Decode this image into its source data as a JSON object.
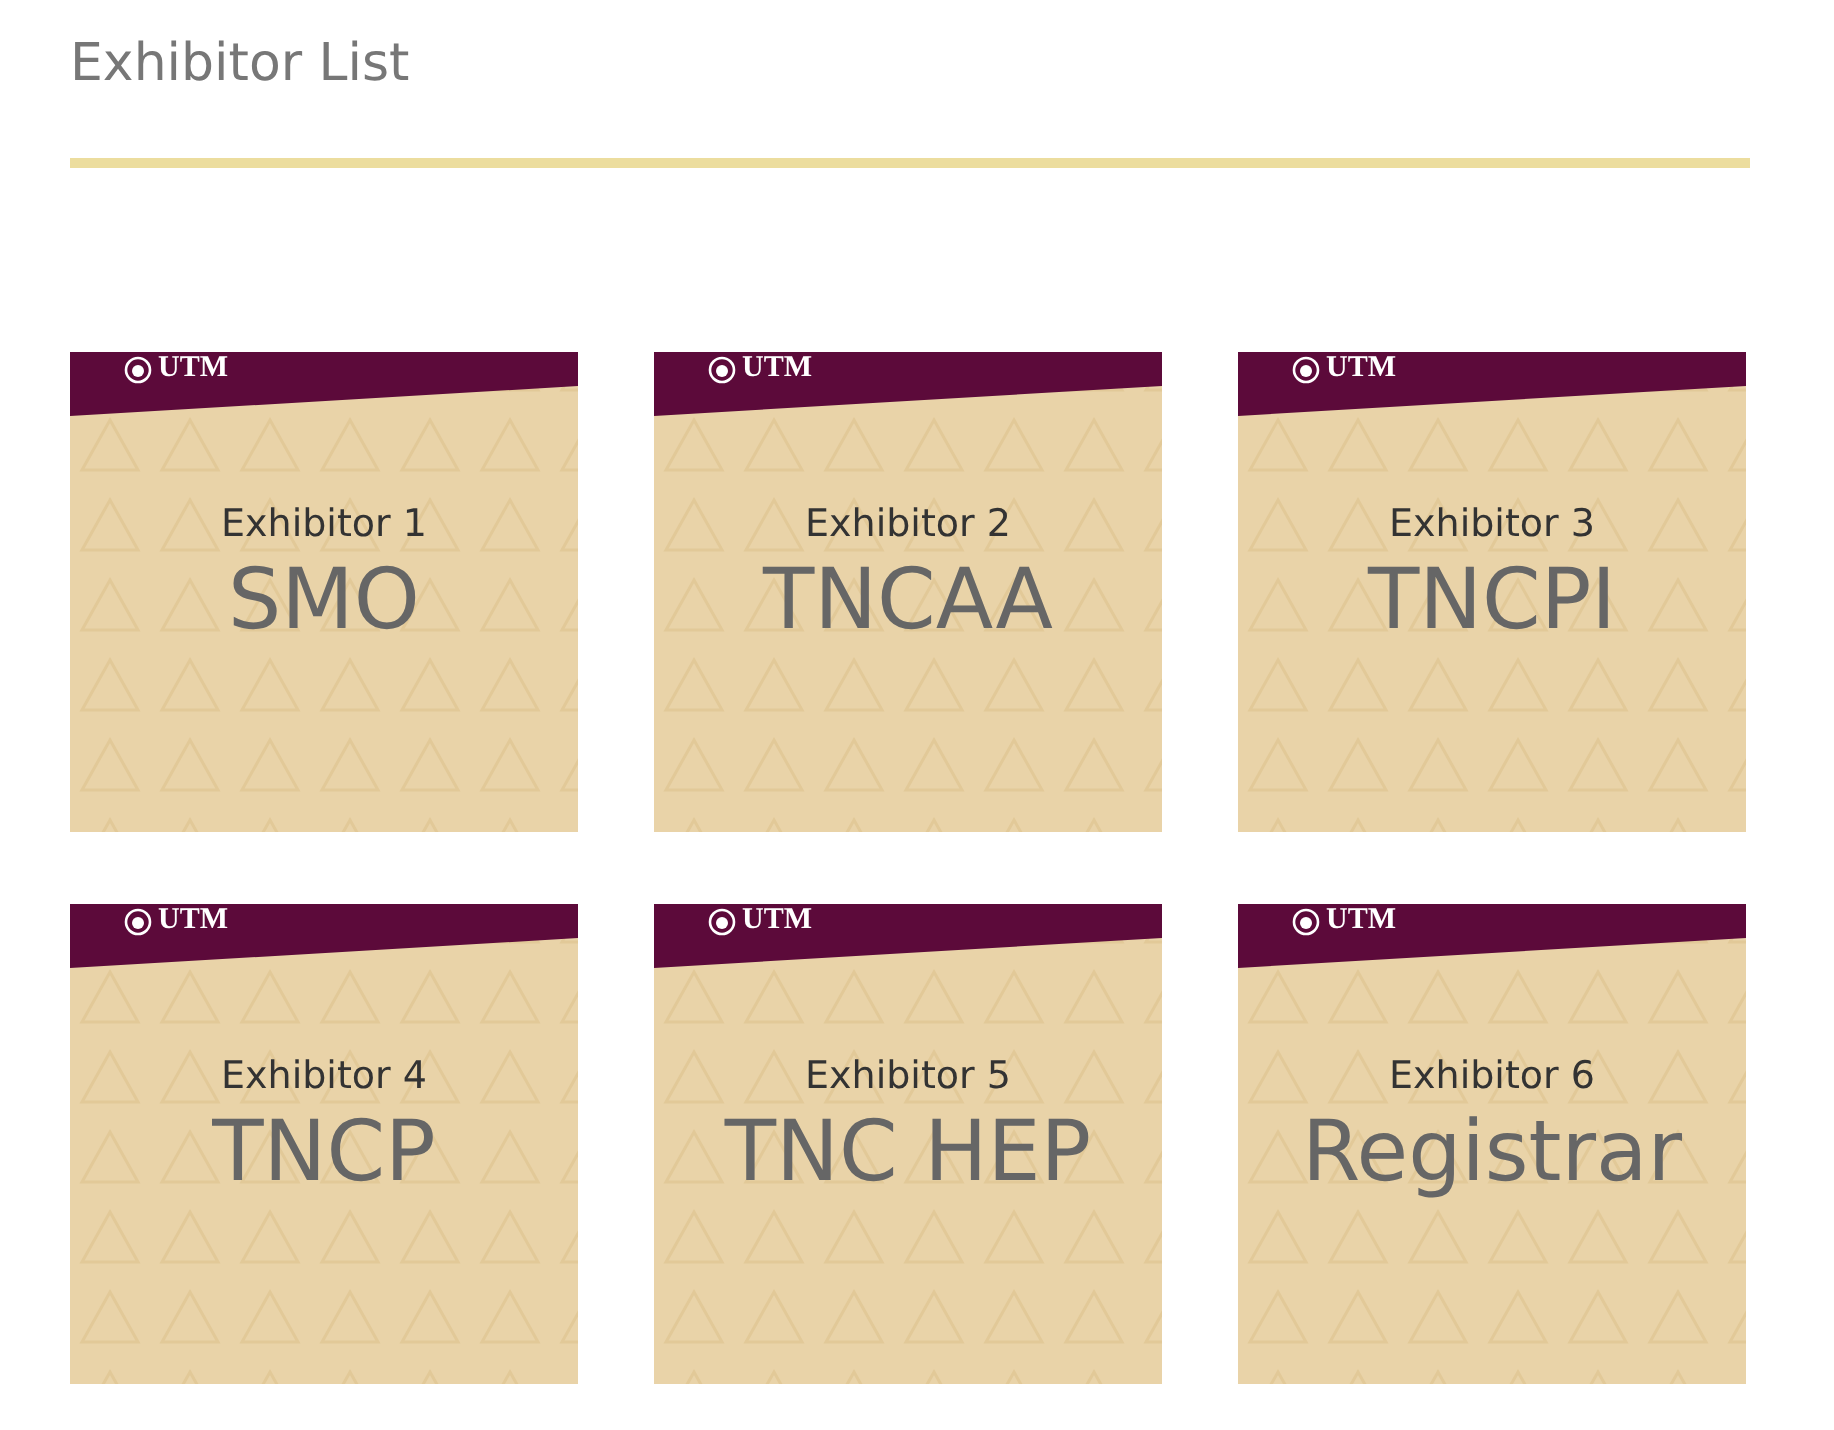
{
  "title": "Exhibitor List",
  "exhibitors": [
    {
      "logo": "UTM",
      "label": "Exhibitor 1",
      "name": "SMO"
    },
    {
      "logo": "UTM",
      "label": "Exhibitor 2",
      "name": "TNCAA"
    },
    {
      "logo": "UTM",
      "label": "Exhibitor 3",
      "name": "TNCPI"
    },
    {
      "logo": "UTM",
      "label": "Exhibitor 4",
      "name": "TNCP"
    },
    {
      "logo": "UTM",
      "label": "Exhibitor 5",
      "name": "TNC HEP"
    },
    {
      "logo": "UTM",
      "label": "Exhibitor 6",
      "name": "Registrar"
    }
  ]
}
